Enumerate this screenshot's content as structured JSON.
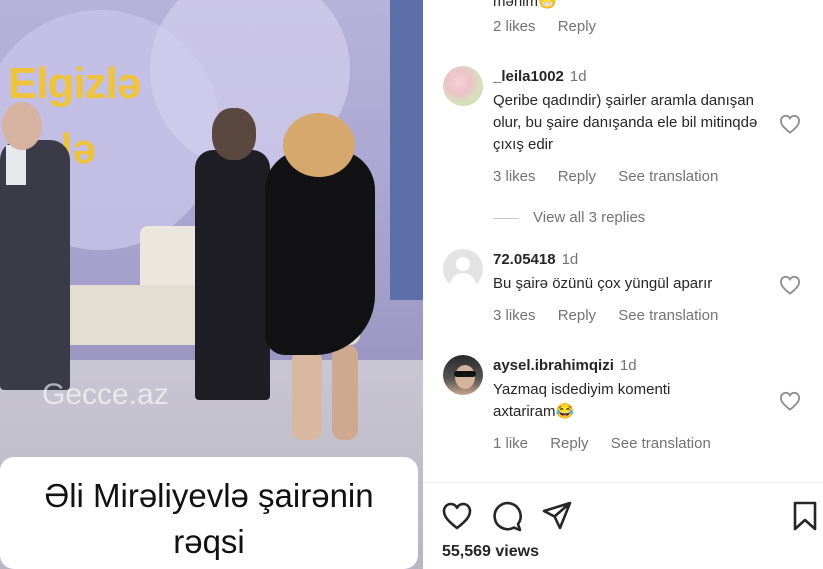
{
  "video": {
    "logo_line1": "Elgizlə",
    "logo_line2": "izlə",
    "watermark": "Gecce.az",
    "caption_line1": "Əli Mirəliyevlə şairənin",
    "caption_line2": "rəqsi"
  },
  "top": {
    "trunc_text": "mənim😁",
    "likes": "2 likes",
    "reply": "Reply"
  },
  "comments": [
    {
      "username": "_leila1002",
      "time": "1d",
      "text": "Qeribe qadındir) şairler aramla danışan olur, bu şaire danışanda ele bil mitinqdə çıxış edir",
      "likes": "3 likes",
      "reply": "Reply",
      "translate": "See translation"
    },
    {
      "username": "72.05418",
      "time": "1d",
      "text": "Bu şairə özünü çox yüngül aparır",
      "likes": "3 likes",
      "reply": "Reply",
      "translate": "See translation"
    },
    {
      "username": "aysel.ibrahimqizi",
      "time": "1d",
      "text": "Yazmaq isdediyim komenti axtariram😂",
      "likes": "1 like",
      "reply": "Reply",
      "translate": "See translation"
    }
  ],
  "view_replies": "View all 3 replies",
  "views": "55,569 views",
  "icons": {
    "like": "heart-icon",
    "comment": "comment-icon",
    "share": "send-icon",
    "save": "bookmark-icon"
  }
}
